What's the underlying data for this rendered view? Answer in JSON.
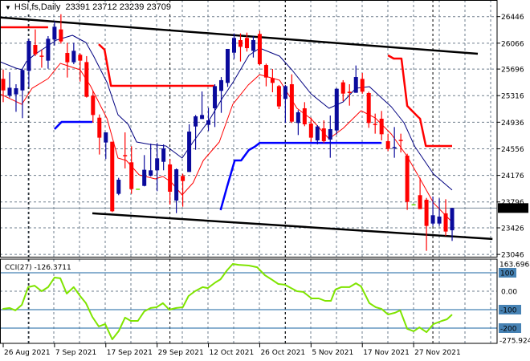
{
  "header": {
    "symbol": "HSI,fs,Daily",
    "ohlc": "23391 23712 23239 23709",
    "menu_icon": "triangle-down-icon"
  },
  "colors": {
    "bull": "#0a0a9c",
    "bear": "#ff0000",
    "doji": "#66dd00",
    "ma_fast": "#ff0000",
    "ma_slow": "#000080",
    "stop_upper": "#ff0000",
    "stop_lower": "#0000ff",
    "trend": "#000000",
    "cci": "#7fe400",
    "cci_level": "#4682b4",
    "grid": "#6e7d8c"
  },
  "chart_data": [
    {
      "type": "candlestick",
      "title": "HSI,fs,Daily",
      "last_price": 23709,
      "last_price_label": "23709",
      "yaxis_ticks": [
        26446,
        26066,
        25696,
        25316,
        24936,
        24556,
        24176,
        23796,
        23426,
        23046
      ],
      "yaxis_tick_labels": [
        "26446",
        "26066",
        "25696",
        "25316",
        "24936",
        "24556",
        "24176",
        "23796",
        "23426",
        "23046"
      ],
      "ylim": [
        23046,
        26446
      ],
      "xaxis_labels": [
        {
          "bar": 1,
          "label": "26 Aug 2021"
        },
        {
          "bar": 9,
          "label": "7 Sep 2021"
        },
        {
          "bar": 17,
          "label": "17 Sep 2021"
        },
        {
          "bar": 25,
          "label": "29 Sep 2021"
        },
        {
          "bar": 33,
          "label": "12 Oct 2021"
        },
        {
          "bar": 41,
          "label": "26 Oct 2021"
        },
        {
          "bar": 49,
          "label": "5 Nov 2021"
        },
        {
          "bar": 57,
          "label": "17 Nov 2021"
        },
        {
          "bar": 65,
          "label": "27 Nov 2021"
        }
      ],
      "month_separators_at_bar": [
        5,
        27,
        45,
        68
      ],
      "candles_ohlc": [
        [
          25556,
          25689,
          25223,
          25391
        ],
        [
          25315,
          25651,
          25288,
          25429
        ],
        [
          25334,
          25479,
          25085,
          25422
        ],
        [
          25391,
          25709,
          24994,
          25682
        ],
        [
          25670,
          26129,
          25441,
          26098
        ],
        [
          26041,
          26263,
          25881,
          25907
        ],
        [
          25888,
          25976,
          25716,
          25873
        ],
        [
          25816,
          26167,
          25701,
          26129
        ],
        [
          26118,
          26378,
          26033,
          26301
        ],
        [
          26263,
          26480,
          26060,
          26091
        ],
        [
          25926,
          26072,
          25575,
          25793
        ],
        [
          25793,
          26072,
          25766,
          25957
        ],
        [
          25900,
          25919,
          25517,
          25816
        ],
        [
          25796,
          25881,
          25288,
          25299
        ],
        [
          25315,
          25384,
          24932,
          25039
        ],
        [
          25001,
          25047,
          24474,
          24715
        ],
        [
          24646,
          24791,
          24409,
          24791
        ],
        [
          24657,
          24657,
          23650,
          23663
        ],
        [
          23912,
          24141,
          23893,
          24114
        ],
        [
          24466,
          24791,
          24275,
          24451
        ],
        [
          24363,
          24592,
          23912,
          23980
        ],
        [
          23977,
          23977,
          23977,
          23977
        ],
        [
          24026,
          24466,
          24019,
          24256
        ],
        [
          24172,
          24630,
          24160,
          24248
        ],
        [
          24248,
          24638,
          23950,
          24420
        ],
        [
          24370,
          24619,
          24248,
          24562
        ],
        [
          24332,
          24409,
          23759,
          23942
        ],
        [
          23816,
          24275,
          23636,
          24263
        ],
        [
          24168,
          24198,
          23728,
          24095
        ],
        [
          24225,
          24906,
          24225,
          24802
        ],
        [
          24875,
          25039,
          24542,
          25020
        ],
        [
          24982,
          25376,
          24982,
          25039
        ],
        [
          24898,
          25143,
          24810,
          24963
        ],
        [
          25135,
          25479,
          24867,
          25452
        ],
        [
          25384,
          25582,
          25070,
          25537
        ],
        [
          25498,
          25984,
          25441,
          25984
        ],
        [
          25930,
          26206,
          25842,
          26141
        ],
        [
          26110,
          26206,
          25804,
          26014
        ],
        [
          26141,
          26217,
          25946,
          25995
        ],
        [
          25957,
          26167,
          25861,
          26110
        ],
        [
          26198,
          26244,
          25747,
          25766
        ],
        [
          25754,
          25774,
          25449,
          25575
        ],
        [
          25567,
          25697,
          25364,
          25498
        ],
        [
          25452,
          25468,
          25124,
          25162
        ],
        [
          25269,
          25468,
          24925,
          25452
        ],
        [
          25479,
          25621,
          24925,
          24944
        ],
        [
          24925,
          25108,
          24753,
          25078
        ],
        [
          25135,
          25223,
          24879,
          24906
        ],
        [
          24917,
          25001,
          24657,
          24715
        ],
        [
          24676,
          24894,
          24619,
          24875
        ],
        [
          24848,
          24963,
          24638,
          24665
        ],
        [
          24688,
          25032,
          24428,
          24837
        ],
        [
          24818,
          25422,
          24760,
          25414
        ],
        [
          25506,
          25537,
          25238,
          25345
        ],
        [
          25372,
          25479,
          25173,
          25353
        ],
        [
          25357,
          25747,
          25357,
          25582
        ],
        [
          25556,
          25640,
          25345,
          25372
        ],
        [
          25353,
          25372,
          24856,
          24925
        ],
        [
          24913,
          25059,
          24772,
          24898
        ],
        [
          24986,
          25097,
          24676,
          24764
        ],
        [
          24665,
          24772,
          24523,
          24554
        ],
        [
          24565,
          24867,
          24428,
          24581
        ],
        [
          24684,
          24772,
          24504,
          24669
        ],
        [
          24458,
          24485,
          23682,
          23797
        ],
        [
          23755,
          23755,
          23755,
          23755
        ],
        [
          23893,
          24141,
          23694,
          23694
        ],
        [
          23828,
          23854,
          23097,
          23453
        ],
        [
          23487,
          23874,
          23453,
          23606
        ],
        [
          23487,
          23847,
          23453,
          23587
        ],
        [
          23633,
          23835,
          23311,
          23373
        ],
        [
          23391,
          23712,
          23239,
          23709
        ]
      ],
      "ma_slow": [
        [
          0.5,
          25800
        ],
        [
          3.0,
          25708
        ],
        [
          3.9,
          25685
        ],
        [
          4.6,
          25800
        ],
        [
          5.9,
          25903
        ],
        [
          9.3,
          26110
        ],
        [
          11.8,
          26179
        ],
        [
          13.9,
          26075
        ],
        [
          15.1,
          25880
        ],
        [
          17.2,
          25502
        ],
        [
          18.9,
          25043
        ],
        [
          20.5,
          24905
        ],
        [
          21.8,
          24653
        ],
        [
          23.9,
          24619
        ],
        [
          26.4,
          24596
        ],
        [
          28.9,
          24424
        ],
        [
          30.6,
          24653
        ],
        [
          33.1,
          24963
        ],
        [
          35.2,
          25284
        ],
        [
          36.8,
          25502
        ],
        [
          39.3,
          25892
        ],
        [
          41.0,
          25995
        ],
        [
          44.1,
          25880
        ],
        [
          46.0,
          25686
        ],
        [
          49.0,
          25342
        ],
        [
          51.8,
          25135
        ],
        [
          54.0,
          25227
        ],
        [
          56.0,
          25422
        ],
        [
          58.1,
          25445
        ],
        [
          59.7,
          25308
        ],
        [
          61.5,
          25158
        ],
        [
          63.5,
          24929
        ],
        [
          65.2,
          24585
        ],
        [
          68.1,
          24195
        ],
        [
          71.0,
          23966
        ]
      ],
      "ma_fast": [
        [
          0.5,
          25340
        ],
        [
          3.9,
          25192
        ],
        [
          5.5,
          25421
        ],
        [
          8.0,
          25559
        ],
        [
          9.9,
          25777
        ],
        [
          13.0,
          25685
        ],
        [
          14.6,
          25456
        ],
        [
          17.2,
          24986
        ],
        [
          18.9,
          24424
        ],
        [
          20.2,
          24389
        ],
        [
          22.2,
          24183
        ],
        [
          24.7,
          24126
        ],
        [
          25.9,
          24160
        ],
        [
          27.2,
          24080
        ],
        [
          28.9,
          23896
        ],
        [
          30.6,
          24068
        ],
        [
          32.2,
          24389
        ],
        [
          34.7,
          24653
        ],
        [
          36.8,
          25192
        ],
        [
          39.2,
          25468
        ],
        [
          41.0,
          25617
        ],
        [
          44.1,
          25536
        ],
        [
          46.8,
          25135
        ],
        [
          49.0,
          24986
        ],
        [
          51.8,
          24699
        ],
        [
          54.0,
          24848
        ],
        [
          56.8,
          25101
        ],
        [
          59.0,
          24998
        ],
        [
          61.5,
          24768
        ],
        [
          64.0,
          24447
        ],
        [
          66.0,
          24126
        ],
        [
          68.1,
          23782
        ],
        [
          71.0,
          23507
        ]
      ],
      "stop_upper": [
        [
          [
            0.5,
            26293
          ],
          [
            8.0,
            26293
          ]
        ],
        [
          [
            15.9,
            26052
          ],
          [
            16.8,
            25972
          ],
          [
            17.8,
            25456
          ],
          [
            33.9,
            25456
          ]
        ],
        [
          [
            61.0,
            25892
          ],
          [
            61.9,
            25846
          ],
          [
            63.1,
            25846
          ],
          [
            64.0,
            25169
          ],
          [
            65.6,
            25020
          ],
          [
            66.0,
            24986
          ],
          [
            66.9,
            24596
          ],
          [
            71.0,
            24596
          ]
        ]
      ],
      "stop_lower": [
        [
          [
            9.0,
            24837
          ],
          [
            10.1,
            24940
          ],
          [
            14.9,
            24940
          ]
        ],
        [
          [
            34.9,
            23679
          ],
          [
            35.9,
            24011
          ],
          [
            37.1,
            24389
          ],
          [
            38.1,
            24389
          ],
          [
            39.3,
            24538
          ],
          [
            40.2,
            24584
          ],
          [
            41.0,
            24641
          ],
          [
            60.0,
            24641
          ]
        ]
      ],
      "trendlines": [
        [
          [
            0.5,
            26435
          ],
          [
            75.0,
            25915
          ]
        ],
        [
          [
            14.9,
            23633
          ],
          [
            77.3,
            23266
          ]
        ]
      ]
    },
    {
      "type": "line",
      "title": "CCI(27)",
      "label": "CCI(27) -126.3711",
      "current_value": -126.3711,
      "ylim": [
        -275.924,
        163.6968
      ],
      "ylim_labels": [
        "163.6968",
        "-275.924"
      ],
      "levels": [
        {
          "value": 100,
          "label": "100"
        },
        {
          "value": -100,
          "label": "-100"
        },
        {
          "value": -200,
          "label": "-200"
        }
      ],
      "zero_label": "0.00",
      "points": [
        [
          0.9,
          -96
        ],
        [
          2.0,
          -91
        ],
        [
          2.9,
          -104
        ],
        [
          3.9,
          -74
        ],
        [
          4.9,
          22
        ],
        [
          5.9,
          30
        ],
        [
          7.0,
          0
        ],
        [
          8.0,
          22
        ],
        [
          9.0,
          74
        ],
        [
          9.9,
          70
        ],
        [
          10.9,
          -13
        ],
        [
          12.0,
          22
        ],
        [
          13.0,
          -26
        ],
        [
          13.9,
          -65
        ],
        [
          14.9,
          -139
        ],
        [
          15.9,
          -191
        ],
        [
          16.9,
          -178
        ],
        [
          18.0,
          -261
        ],
        [
          19.0,
          -217
        ],
        [
          20.0,
          -143
        ],
        [
          20.9,
          -161
        ],
        [
          22.0,
          -161
        ],
        [
          23.0,
          -109
        ],
        [
          24.0,
          -91
        ],
        [
          24.9,
          -87
        ],
        [
          25.9,
          -65
        ],
        [
          26.9,
          -100
        ],
        [
          28.0,
          -91
        ],
        [
          29.0,
          -87
        ],
        [
          29.9,
          -26
        ],
        [
          30.9,
          0
        ],
        [
          32.1,
          22
        ],
        [
          32.9,
          17
        ],
        [
          34.1,
          48
        ],
        [
          34.9,
          65
        ],
        [
          35.9,
          113
        ],
        [
          36.8,
          148
        ],
        [
          37.7,
          143
        ],
        [
          39.3,
          139
        ],
        [
          40.6,
          130
        ],
        [
          41.8,
          87
        ],
        [
          42.8,
          65
        ],
        [
          43.9,
          39
        ],
        [
          44.9,
          35
        ],
        [
          46.8,
          0
        ],
        [
          47.8,
          -4
        ],
        [
          49.1,
          -39
        ],
        [
          50.2,
          -39
        ],
        [
          51.2,
          -52
        ],
        [
          52.1,
          -52
        ],
        [
          52.8,
          9
        ],
        [
          53.7,
          22
        ],
        [
          55.0,
          22
        ],
        [
          56.0,
          43
        ],
        [
          56.8,
          26
        ],
        [
          58.1,
          -65
        ],
        [
          59.1,
          -87
        ],
        [
          60.0,
          -96
        ],
        [
          61.0,
          -126
        ],
        [
          62.1,
          -117
        ],
        [
          62.9,
          -104
        ],
        [
          64.0,
          -204
        ],
        [
          65.0,
          -217
        ],
        [
          65.9,
          -196
        ],
        [
          67.0,
          -222
        ],
        [
          68.1,
          -178
        ],
        [
          69.4,
          -161
        ],
        [
          70.2,
          -152
        ],
        [
          71.0,
          -126.37
        ]
      ]
    }
  ]
}
